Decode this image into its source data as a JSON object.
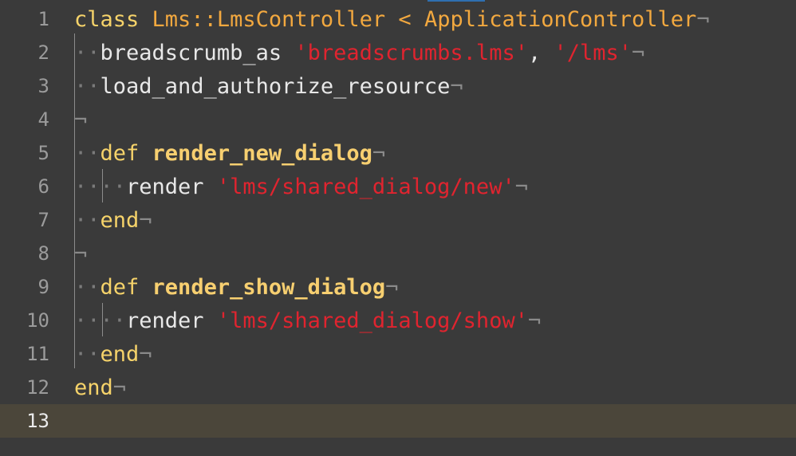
{
  "editor": {
    "lines": [
      {
        "num": "1",
        "segments": [
          {
            "t": "class ",
            "c": "kw"
          },
          {
            "t": "Lms::LmsController",
            "c": "cls"
          },
          {
            "t": " < ",
            "c": "cls"
          },
          {
            "t": "ApplicationController",
            "c": "cls"
          },
          {
            "t": "¬",
            "c": "eol"
          }
        ]
      },
      {
        "num": "2",
        "segments": [
          {
            "t": "··",
            "c": "ws"
          },
          {
            "t": "breadscrumb_as ",
            "c": "plain"
          },
          {
            "t": "'breadscrumbs.lms'",
            "c": "str"
          },
          {
            "t": ", ",
            "c": "plain"
          },
          {
            "t": "'/lms'",
            "c": "str"
          },
          {
            "t": "¬",
            "c": "eol"
          }
        ]
      },
      {
        "num": "3",
        "segments": [
          {
            "t": "··",
            "c": "ws"
          },
          {
            "t": "load_and_authorize_resource",
            "c": "plain"
          },
          {
            "t": "¬",
            "c": "eol"
          }
        ]
      },
      {
        "num": "4",
        "segments": [
          {
            "t": "¬",
            "c": "eol"
          }
        ]
      },
      {
        "num": "5",
        "segments": [
          {
            "t": "··",
            "c": "ws"
          },
          {
            "t": "def ",
            "c": "kw"
          },
          {
            "t": "render_new_dialog",
            "c": "fn"
          },
          {
            "t": "¬",
            "c": "eol"
          }
        ]
      },
      {
        "num": "6",
        "segments": [
          {
            "t": "··",
            "c": "ws"
          },
          {
            "t": "··",
            "c": "ws"
          },
          {
            "t": "render ",
            "c": "plain"
          },
          {
            "t": "'lms/shared_dialog/new'",
            "c": "str"
          },
          {
            "t": "¬",
            "c": "eol"
          }
        ]
      },
      {
        "num": "7",
        "segments": [
          {
            "t": "··",
            "c": "ws"
          },
          {
            "t": "end",
            "c": "kw"
          },
          {
            "t": "¬",
            "c": "eol"
          }
        ]
      },
      {
        "num": "8",
        "segments": [
          {
            "t": "¬",
            "c": "eol"
          }
        ]
      },
      {
        "num": "9",
        "segments": [
          {
            "t": "··",
            "c": "ws"
          },
          {
            "t": "def ",
            "c": "kw"
          },
          {
            "t": "render_show_dialog",
            "c": "fn"
          },
          {
            "t": "¬",
            "c": "eol"
          }
        ]
      },
      {
        "num": "10",
        "segments": [
          {
            "t": "··",
            "c": "ws"
          },
          {
            "t": "··",
            "c": "ws"
          },
          {
            "t": "render ",
            "c": "plain"
          },
          {
            "t": "'lms/shared_dialog/show'",
            "c": "str"
          },
          {
            "t": "¬",
            "c": "eol"
          }
        ]
      },
      {
        "num": "11",
        "segments": [
          {
            "t": "··",
            "c": "ws"
          },
          {
            "t": "end",
            "c": "kw"
          },
          {
            "t": "¬",
            "c": "eol"
          }
        ]
      },
      {
        "num": "12",
        "segments": [
          {
            "t": "end",
            "c": "kw"
          },
          {
            "t": "¬",
            "c": "eol"
          }
        ]
      },
      {
        "num": "13",
        "segments": [],
        "current": true
      }
    ]
  },
  "colors": {
    "background": "#3a3a3a",
    "current_line": "#4b463a",
    "keyword": "#f6d36a",
    "class_name": "#f2a83f",
    "string": "#e0242f",
    "invisibles": "#8a8a8a"
  }
}
